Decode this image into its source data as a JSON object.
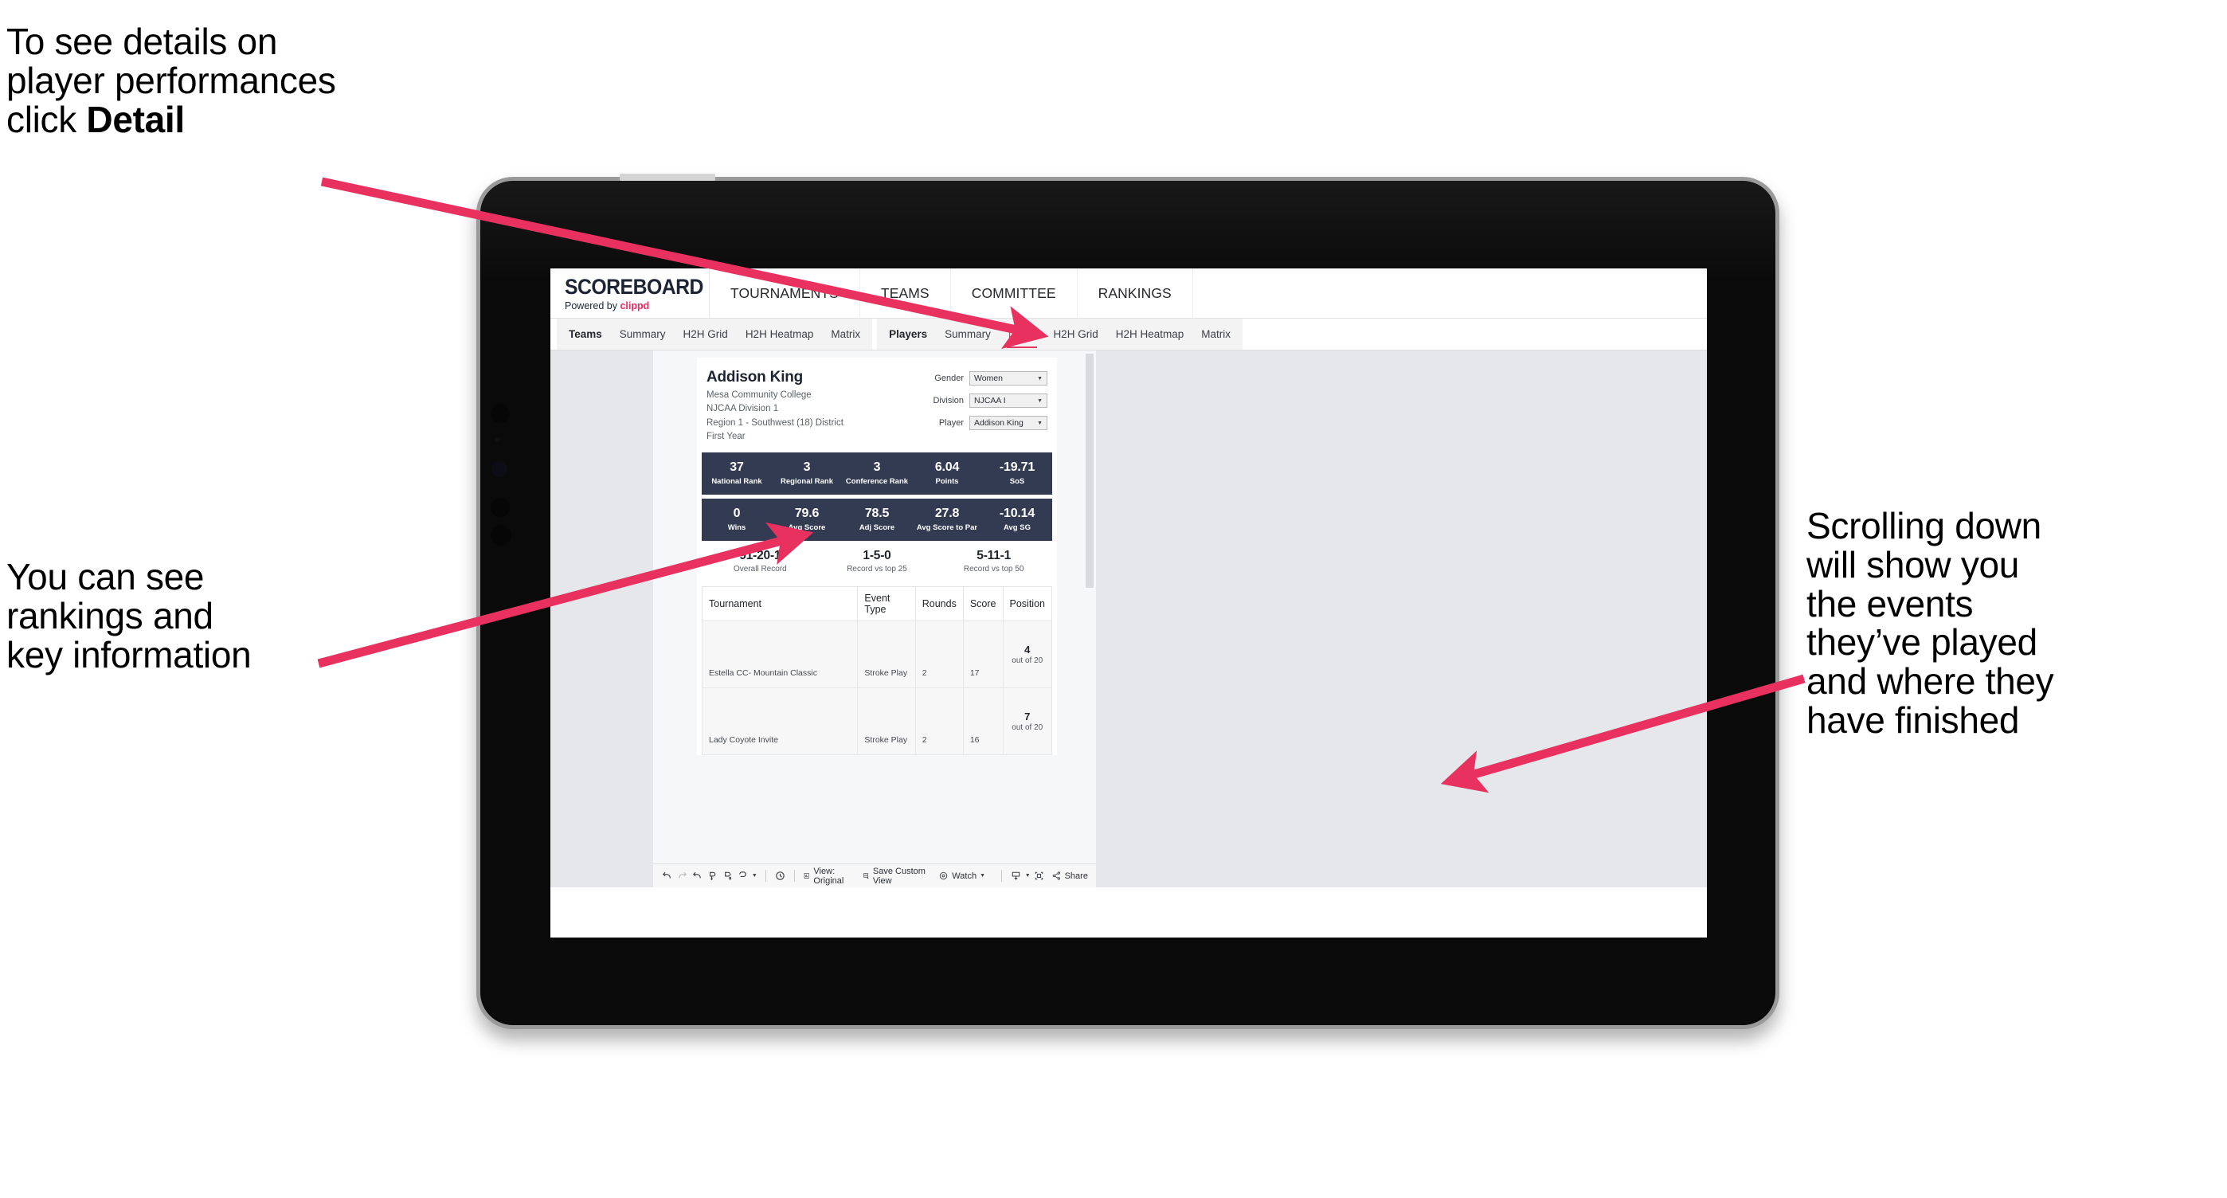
{
  "annotations": {
    "detail": {
      "lines": [
        "To see details on",
        "player performances",
        "click "
      ],
      "bold_word": "Detail"
    },
    "rankings": {
      "lines": [
        "You can see",
        "rankings and",
        "key information"
      ]
    },
    "scrolling": {
      "lines": [
        "Scrolling down",
        "will show you",
        "the events",
        "they’ve played",
        "and where they",
        "have finished"
      ]
    },
    "arrow_color": "#e8315f"
  },
  "app": {
    "brand": {
      "title": "SCOREBOARD",
      "powered_prefix": "Powered by ",
      "powered_name": "clippd"
    },
    "topnav": [
      "TOURNAMENTS",
      "TEAMS",
      "COMMITTEE",
      "RANKINGS"
    ],
    "tabs_group1": [
      "Teams",
      "Summary",
      "H2H Grid",
      "H2H Heatmap",
      "Matrix"
    ],
    "tabs_group2": [
      "Players",
      "Summary",
      "Detail",
      "H2H Grid",
      "H2H Heatmap",
      "Matrix"
    ],
    "active_tab": "Detail",
    "accent_color": "#e8345f",
    "statbar_color": "#333b52"
  },
  "player": {
    "name": "Addison King",
    "meta": [
      "Mesa Community College",
      "NJCAA Division 1",
      "Region 1 - Southwest (18) District",
      "First Year"
    ]
  },
  "selectors": [
    {
      "label": "Gender",
      "value": "Women"
    },
    {
      "label": "Division",
      "value": "NJCAA I"
    },
    {
      "label": "Player",
      "value": "Addison King"
    }
  ],
  "stats_row1": [
    {
      "value": "37",
      "label": "National Rank"
    },
    {
      "value": "3",
      "label": "Regional Rank"
    },
    {
      "value": "3",
      "label": "Conference Rank"
    },
    {
      "value": "6.04",
      "label": "Points"
    },
    {
      "value": "-19.71",
      "label": "SoS"
    }
  ],
  "stats_row2": [
    {
      "value": "0",
      "label": "Wins"
    },
    {
      "value": "79.6",
      "label": "Avg Score"
    },
    {
      "value": "78.5",
      "label": "Adj Score"
    },
    {
      "value": "27.8",
      "label": "Avg Score to Par"
    },
    {
      "value": "-10.14",
      "label": "Avg SG"
    }
  ],
  "records": [
    {
      "value": "91-20-1",
      "label": "Overall Record"
    },
    {
      "value": "1-5-0",
      "label": "Record vs top 25"
    },
    {
      "value": "5-11-1",
      "label": "Record vs top 50"
    }
  ],
  "table": {
    "headers": [
      "Tournament",
      "Event Type",
      "Rounds",
      "Score",
      "Position"
    ],
    "rows": [
      {
        "tournament": "Estella CC- Mountain Classic",
        "event_type": "Stroke Play",
        "rounds": "2",
        "score": "17",
        "position": "4",
        "position_of": "out of 20"
      },
      {
        "tournament": "Lady Coyote Invite",
        "event_type": "Stroke Play",
        "rounds": "2",
        "score": "16",
        "position": "7",
        "position_of": "out of 20"
      }
    ]
  },
  "toolbar": {
    "icons": [
      "undo-icon",
      "redo-icon",
      "revert-icon",
      "refresh-icon",
      "pause-icon",
      "loop-icon"
    ],
    "view_label": "View: Original",
    "save_label": "Save Custom View",
    "watch_label": "Watch",
    "share_label": "Share"
  }
}
